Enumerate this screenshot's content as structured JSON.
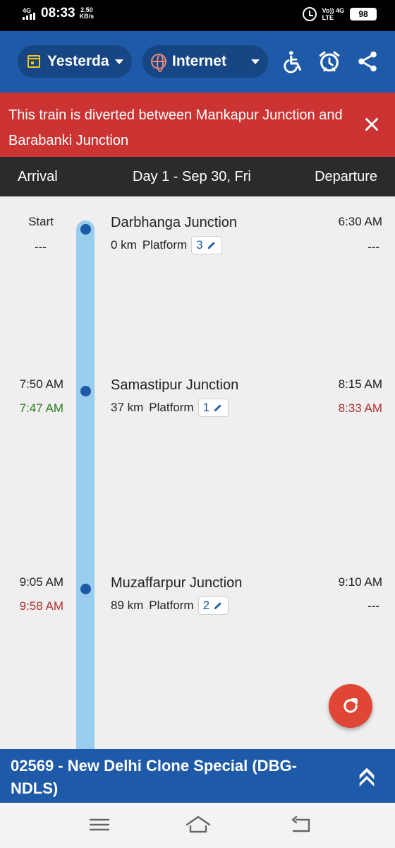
{
  "status_bar": {
    "network": "4G",
    "time": "08:33",
    "speed_value": "2.50",
    "speed_unit": "KB/s",
    "volte": "Vo))",
    "lte_label": "LTE",
    "net2": "4G",
    "battery": "98"
  },
  "toolbar": {
    "date_label": "Yesterda",
    "source_label": "Internet",
    "icons": [
      "wheelchair-icon",
      "alarm-icon",
      "share-icon"
    ],
    "accent": "#1e5aa8"
  },
  "alert": {
    "text": "This train is diverted between Mankapur Junction and Barabanki Junction",
    "color": "#cc3333"
  },
  "header": {
    "arrival": "Arrival",
    "day": "Day 1 - Sep 30, Fri",
    "departure": "Departure"
  },
  "stations": [
    {
      "name": "Darbhanga Junction",
      "km": "0 km",
      "platform_label": "Platform",
      "platform": "3",
      "arr_sched": "Start",
      "arr_actual": "---",
      "dep_sched": "6:30 AM",
      "dep_actual": "---"
    },
    {
      "name": "Samastipur Junction",
      "km": "37 km",
      "platform_label": "Platform",
      "platform": "1",
      "arr_sched": "7:50 AM",
      "arr_actual": "7:47 AM",
      "dep_sched": "8:15 AM",
      "dep_actual": "8:33 AM"
    },
    {
      "name": "Muzaffarpur Junction",
      "km": "89 km",
      "platform_label": "Platform",
      "platform": "2",
      "arr_sched": "9:05 AM",
      "arr_actual": "9:58 AM",
      "dep_sched": "9:10 AM",
      "dep_actual": "---"
    }
  ],
  "train": {
    "title": "02569 - New Delhi Clone Special (DBG-NDLS)"
  },
  "colors": {
    "on_time": "#2e7d22",
    "late": "#b03030",
    "track": "#99cdee",
    "fab": "#e04636"
  }
}
